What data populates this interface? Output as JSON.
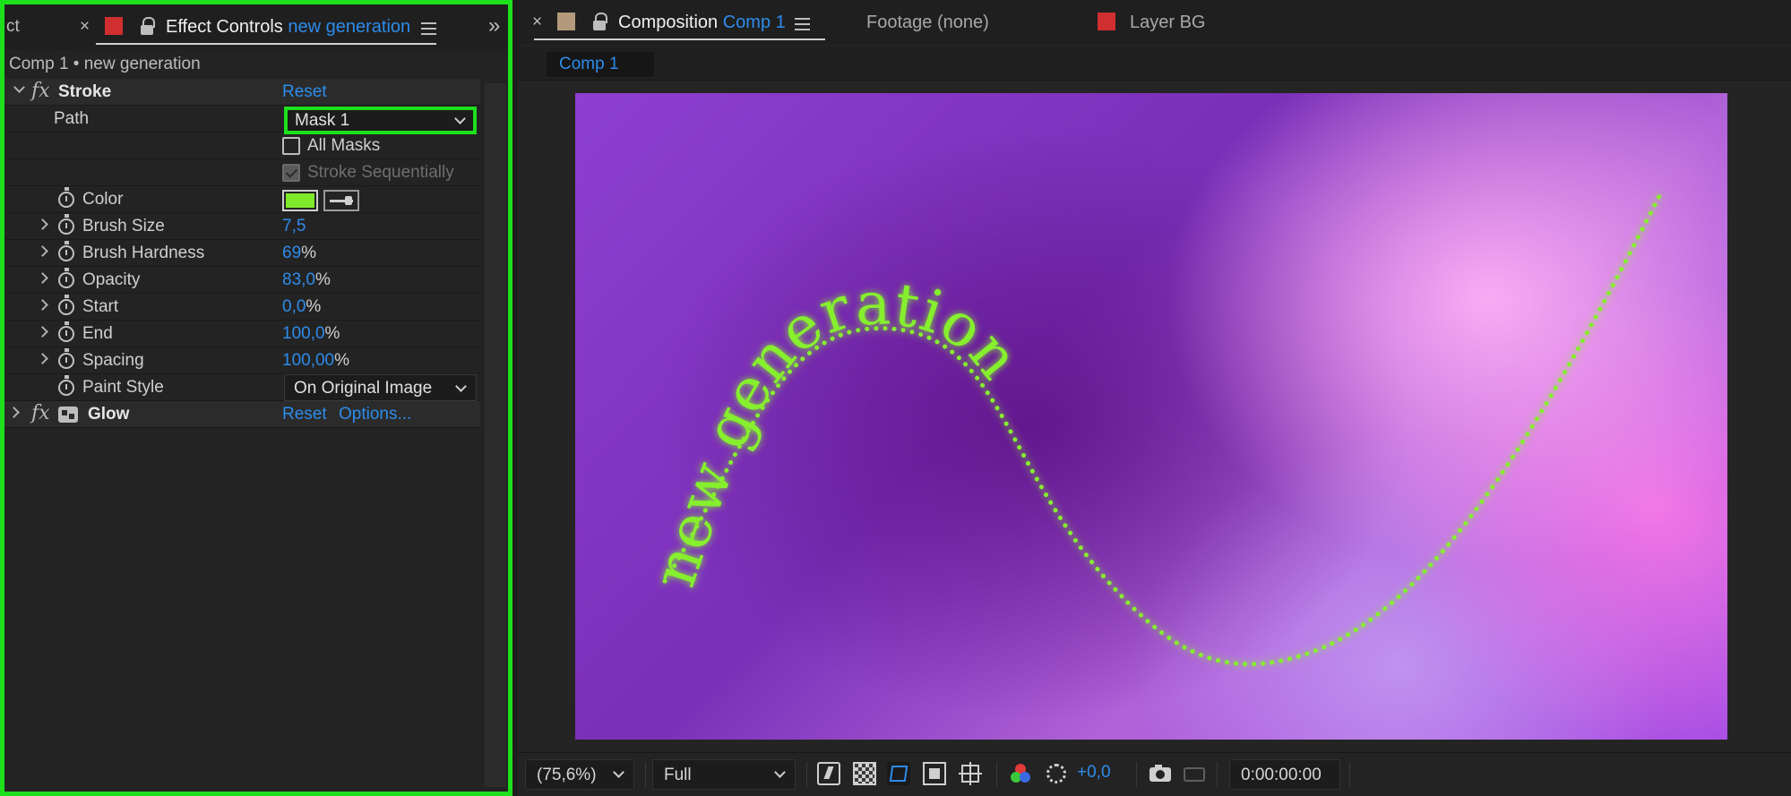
{
  "effect_controls": {
    "cut_tab_label": "ct",
    "close_glyph": "×",
    "tab_label": "Effect Controls",
    "tab_layer": "new generation",
    "subtitle": "Comp 1 • new generation",
    "expand_glyph": "»",
    "label_color": "#c8a0ff",
    "stroke": {
      "name": "Stroke",
      "reset": "Reset",
      "path_label": "Path",
      "path_value": "Mask 1",
      "all_masks": "All Masks",
      "stroke_sequentially": "Stroke Sequentially",
      "color_label": "Color",
      "color_value": "#7fea2a",
      "props": [
        {
          "label": "Brush Size",
          "value": "7,5",
          "unit": ""
        },
        {
          "label": "Brush Hardness",
          "value": "69",
          "unit": "%"
        },
        {
          "label": "Opacity",
          "value": "83,0",
          "unit": "%"
        },
        {
          "label": "Start",
          "value": "0,0",
          "unit": "%"
        },
        {
          "label": "End",
          "value": "100,0",
          "unit": "%"
        },
        {
          "label": "Spacing",
          "value": "100,00",
          "unit": "%"
        }
      ],
      "paint_style_label": "Paint Style",
      "paint_style_value": "On Original Image"
    },
    "glow": {
      "name": "Glow",
      "reset": "Reset",
      "options": "Options..."
    },
    "fx_glyph": "fx"
  },
  "composition": {
    "close_glyph": "×",
    "tab_label": "Composition",
    "tab_comp": "Comp 1",
    "footage_tab": "Footage (none)",
    "layer_tab": "Layer BG",
    "subtab": "Comp 1",
    "canvas_text": "new generation",
    "text_color": "#86ef2e",
    "footer": {
      "zoom": "(75,6%)",
      "resolution": "Full",
      "exposure": "+0,0",
      "timecode": "0:00:00:00"
    }
  },
  "colors": {
    "highlight": "#1de01d",
    "accent_blue": "#2d8ceb",
    "label_red": "#d12f2f",
    "label_tan": "#b49a7c"
  }
}
